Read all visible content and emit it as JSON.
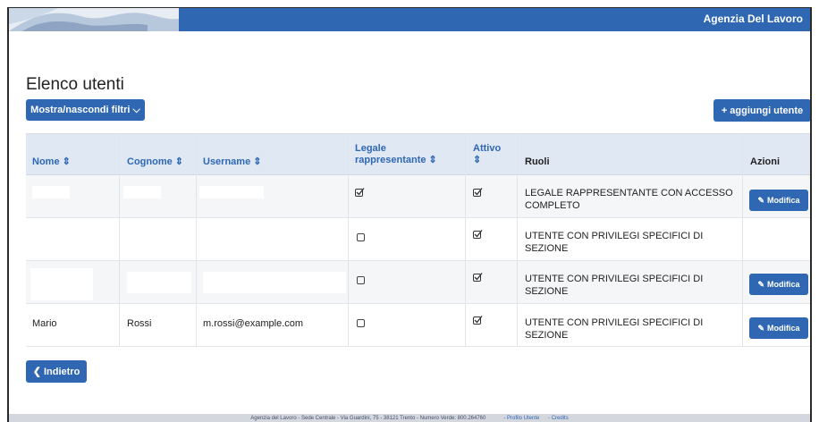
{
  "header": {
    "brand": "Agenzia Del Lavoro"
  },
  "page": {
    "title": "Elenco utenti",
    "filter_button": "Mostra/nascondi filtri ⌵",
    "add_user_button": "+ aggiungi utente",
    "back_button": "❮ Indietro"
  },
  "table": {
    "columns": [
      "Nome ⇕",
      "Cognome ⇕",
      "Username ⇕",
      "Legale rappresentante ⇕",
      "Attivo ⇕",
      "Ruoli",
      "Azioni"
    ],
    "rows": [
      {
        "nome": "",
        "cognome": "",
        "username": "",
        "legale_rappresentante": true,
        "attivo": true,
        "ruoli": "LEGALE RAPPRESENTANTE CON ACCESSO COMPLETO",
        "azione": "Modifica"
      },
      {
        "nome": "",
        "cognome": "",
        "username": "",
        "legale_rappresentante": false,
        "attivo": true,
        "ruoli": "UTENTE CON PRIVILEGI SPECIFICI DI SEZIONE",
        "azione": ""
      },
      {
        "nome": "",
        "cognome": "",
        "username": "",
        "legale_rappresentante": false,
        "attivo": true,
        "ruoli": "UTENTE CON PRIVILEGI SPECIFICI DI SEZIONE",
        "azione": "Modifica"
      },
      {
        "nome": "Mario",
        "cognome": "Rossi",
        "username": "m.rossi@example.com",
        "legale_rappresentante": false,
        "attivo": true,
        "ruoli": "UTENTE CON PRIVILEGI SPECIFICI DI SEZIONE",
        "azione": "Modifica"
      }
    ]
  },
  "footer": {
    "text": "Agenzia del Lavoro - Sede Centrale - Via Guardini, 75 - 38121 Trento - Numero Verde: 800.264760",
    "profile_link": "- Profilo Utente",
    "credits_link": "- Credits"
  },
  "colors": {
    "primary": "#2f67b3",
    "table_header": "#dfe8f3"
  }
}
